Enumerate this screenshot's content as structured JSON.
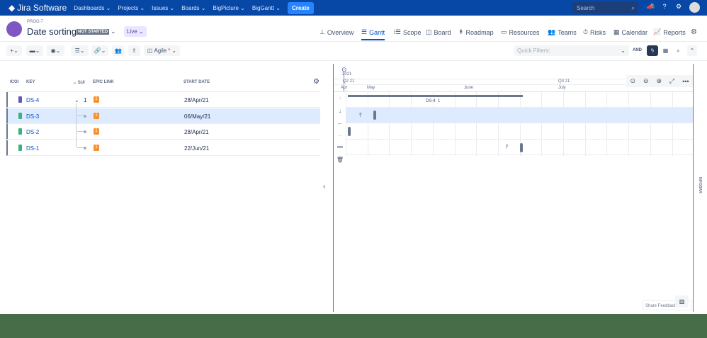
{
  "nav": {
    "logo": "Jira Software",
    "menus": [
      "Dashboards ⌄",
      "Projects ⌄",
      "Issues ⌄",
      "Boards ⌄",
      "BigPicture ⌄",
      "BigGantt ⌄"
    ],
    "create": "Create",
    "search_placeholder": "Search"
  },
  "header": {
    "project_key": "PROG-7",
    "title": "Date sorting",
    "status": "NOT STARTED",
    "mode": "Live ⌄"
  },
  "tabs": [
    {
      "label": "Overview",
      "icon": "⊥"
    },
    {
      "label": "Gantt",
      "icon": "☰"
    },
    {
      "label": "Scope",
      "icon": "⁝☰"
    },
    {
      "label": "Board",
      "icon": "◫"
    },
    {
      "label": "Roadmap",
      "icon": "⇞"
    },
    {
      "label": "Resources",
      "icon": "▭"
    },
    {
      "label": "Teams",
      "icon": "👥"
    },
    {
      "label": "Risks",
      "icon": "⏱"
    },
    {
      "label": "Calendar",
      "icon": "▦"
    },
    {
      "label": "Reports",
      "icon": "📈"
    }
  ],
  "toolbar": {
    "view": "Agile",
    "view_mark": "*",
    "quick_filters": "Quick Filters:",
    "and": "AND"
  },
  "table": {
    "headers": [
      "ICOI",
      "KEY",
      "SUI",
      "EPIC LINK",
      "START DATE"
    ],
    "rows": [
      {
        "key": "DS-4",
        "sub": "1",
        "epic": "1",
        "start": "28/Apr/21",
        "type": "epic"
      },
      {
        "key": "DS-3",
        "sub": "",
        "epic": "1",
        "start": "06/May/21",
        "type": "story"
      },
      {
        "key": "DS-2",
        "sub": "",
        "epic": "1",
        "start": "28/Apr/21",
        "type": "story"
      },
      {
        "key": "DS-1",
        "sub": "",
        "epic": "1",
        "start": "22/Jun/21",
        "type": "story"
      }
    ]
  },
  "timeline": {
    "year": "2021",
    "quarters": [
      "Q2 21",
      "Q3 21"
    ],
    "months": [
      "Apr",
      "May",
      "June",
      "July"
    ],
    "summary_label": "DS-4",
    "summary_count": "1"
  },
  "infobar": "INFOBAR",
  "feedback": "Share Feedback",
  "colors": {
    "nav": "#0747a6",
    "accent": "#0052cc",
    "selected": "#deebff",
    "footer": "#476d48"
  }
}
